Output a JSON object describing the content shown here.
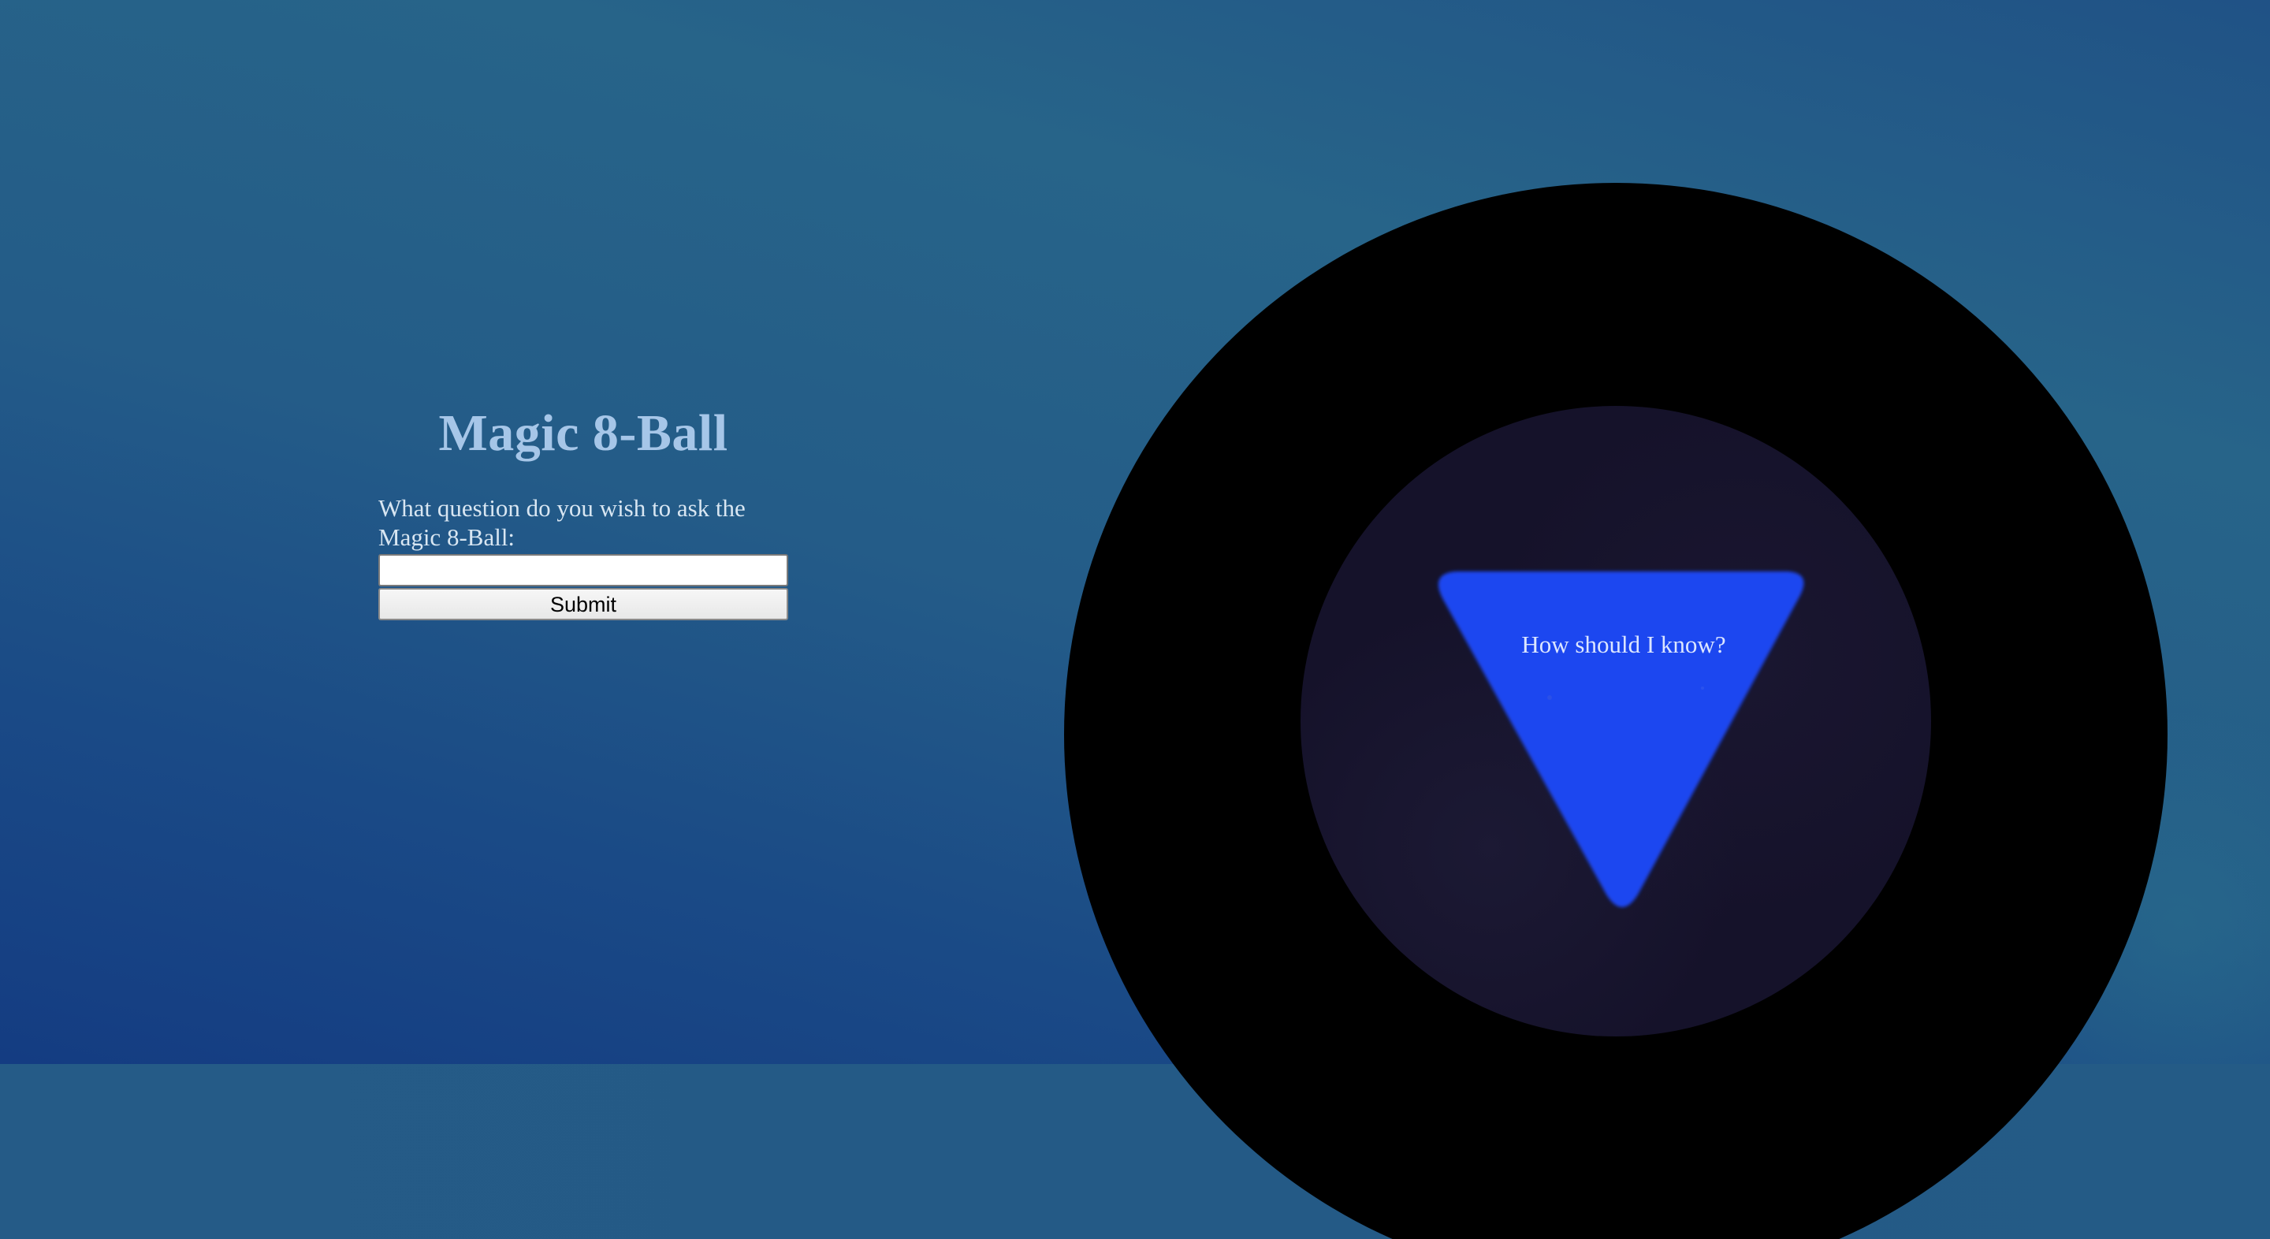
{
  "page": {
    "title": "Magic 8-Ball"
  },
  "form": {
    "label": "What question do you wish to ask the Magic 8-Ball:",
    "input_value": "",
    "input_placeholder": "",
    "submit_label": "Submit"
  },
  "ball": {
    "answer": "How should I know?"
  },
  "colors": {
    "background": "#245a86",
    "title": "#a6c6e8",
    "ball": "#000000",
    "window": "#15122a",
    "triangle": "#1e46f0"
  }
}
